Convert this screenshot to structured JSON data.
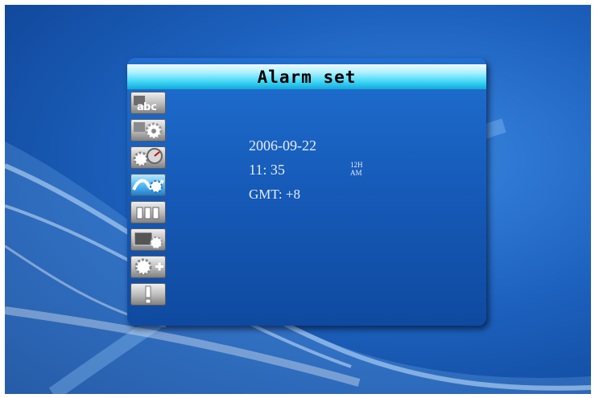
{
  "window": {
    "title": "Alarm set"
  },
  "menu": {
    "items": [
      {
        "icon": "abc-language-icon"
      },
      {
        "icon": "gear-settings-icon"
      },
      {
        "icon": "gauge-tools-icon"
      },
      {
        "icon": "network-config-icon"
      },
      {
        "icon": "channel-bars-icon"
      },
      {
        "icon": "screen-gear-icon"
      },
      {
        "icon": "gear-plus-icon"
      },
      {
        "icon": "exclamation-info-icon"
      }
    ],
    "active_index": 3
  },
  "clock": {
    "date": "2006-09-22",
    "time": "11: 35",
    "format": "12H",
    "meridiem": "AM",
    "gmt": "GMT: +8"
  },
  "colors": {
    "title_bar": "#3cd6f5",
    "panel": "#1558b5",
    "background": "#1d62bf"
  }
}
